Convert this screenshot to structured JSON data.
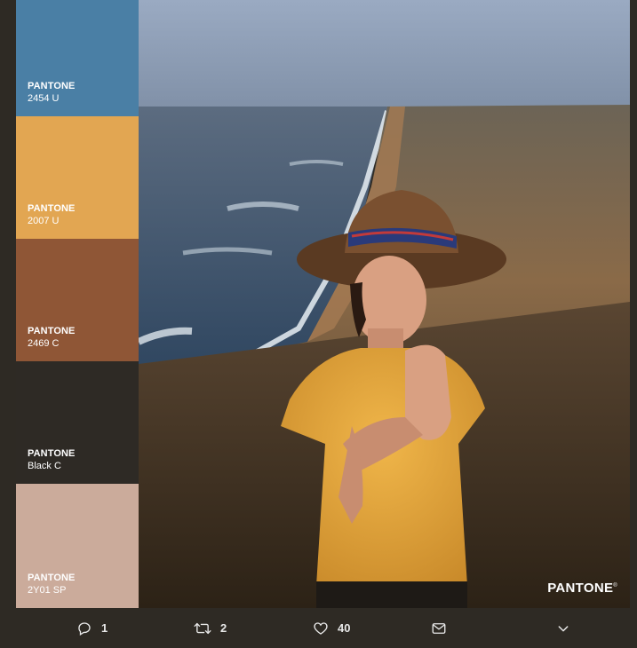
{
  "palette": {
    "swatches": [
      {
        "brand": "PANTONE",
        "code": "2454 U",
        "color": "#4a7fa5"
      },
      {
        "brand": "PANTONE",
        "code": "2007 U",
        "color": "#e2a652"
      },
      {
        "brand": "PANTONE",
        "code": "2469 C",
        "color": "#8f5636"
      },
      {
        "brand": "PANTONE",
        "code": "Black C",
        "color": "#2e2a25"
      },
      {
        "brand": "PANTONE",
        "code": "2Y01 SP",
        "color": "#cbab9b"
      }
    ]
  },
  "photo": {
    "logo": "PANTONE",
    "logo_mark": "®"
  },
  "actions": {
    "reply": {
      "count": "1",
      "icon": "reply-icon"
    },
    "retweet": {
      "count": "2",
      "icon": "retweet-icon"
    },
    "like": {
      "count": "40",
      "icon": "heart-icon"
    },
    "message": {
      "icon": "envelope-icon"
    },
    "more": {
      "icon": "chevron-down-icon"
    }
  },
  "colors": {
    "background": "#2e2a24",
    "text": "#e8e8e8"
  }
}
